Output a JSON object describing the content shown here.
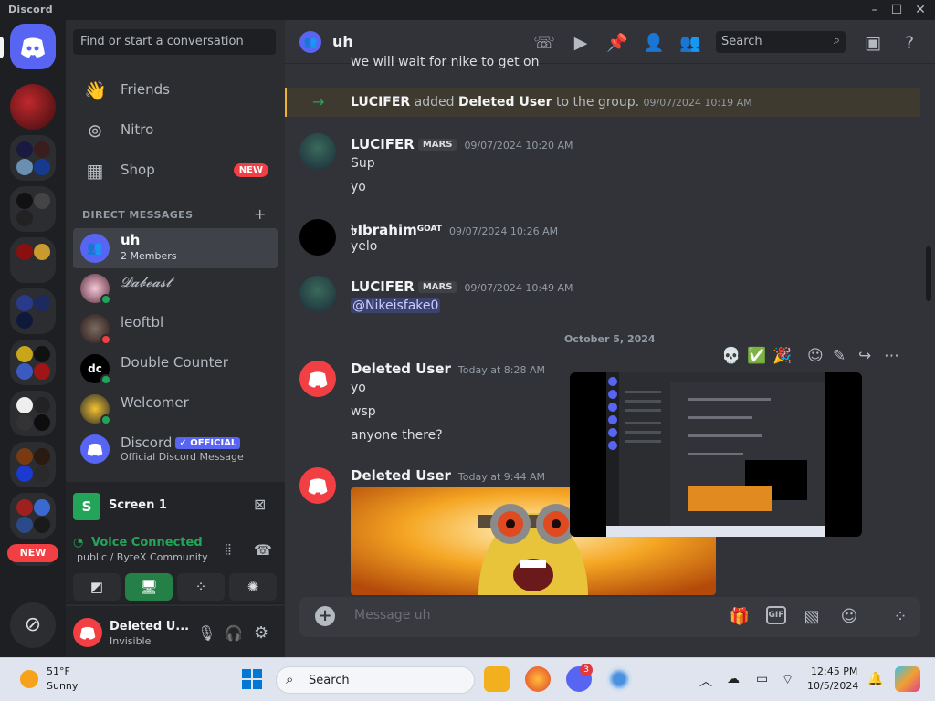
{
  "window": {
    "title": "Discord"
  },
  "rail": {
    "new_badge": "NEW"
  },
  "sidebar": {
    "search_placeholder": "Find or start a conversation",
    "nav": [
      {
        "label": "Friends",
        "icon": "friends-icon"
      },
      {
        "label": "Nitro",
        "icon": "nitro-icon"
      },
      {
        "label": "Shop",
        "icon": "shop-icon",
        "badge": "NEW"
      }
    ],
    "dm_header": "DIRECT MESSAGES",
    "dms": [
      {
        "name": "uh",
        "sub": "2 Members",
        "active": true
      },
      {
        "name": "𝓓𝓪𝓫𝓮𝓪𝓼𝓽"
      },
      {
        "name": "leoftbl"
      },
      {
        "name": "Double Counter"
      },
      {
        "name": "Welcomer"
      },
      {
        "name": "Discord",
        "badge": "✓ OFFICIAL",
        "sub": "Official Discord Message"
      }
    ]
  },
  "voice": {
    "screen_label": "Screen 1",
    "screen_letter": "S",
    "status": "Voice Connected",
    "channel": "public / ByteX Community"
  },
  "user": {
    "name": "Deleted U...",
    "status": "Invisible"
  },
  "chat": {
    "title": "uh",
    "search_placeholder": "Search",
    "clipped_line": "we will wait for nike to get on",
    "system": {
      "actor": "LUCIFER",
      "verb": "added",
      "target": "Deleted User",
      "rest": "to the group.",
      "time": "09/07/2024 10:19 AM"
    },
    "messages": [
      {
        "author": "LUCIFER",
        "tag": "MARS",
        "time": "09/07/2024 10:20 AM",
        "lines": [
          "Sup",
          "yo"
        ]
      },
      {
        "author": "৳Ibrahim",
        "suffix": "GOAT",
        "time": "09/07/2024 10:26 AM",
        "lines": [
          "yelo"
        ]
      },
      {
        "author": "LUCIFER",
        "tag": "MARS",
        "time": "09/07/2024 10:49 AM",
        "mention": "@Nikeisfake0"
      },
      {
        "author": "Deleted User",
        "time": "Today at 8:28 AM",
        "lines": [
          "yo",
          "wsp",
          "anyone there?"
        ]
      },
      {
        "author": "Deleted User",
        "time": "Today at 9:44 AM"
      }
    ],
    "date_divider": "October 5, 2024",
    "composer_placeholder": "Message uh",
    "gif_label": "GIF"
  },
  "taskbar": {
    "temp": "51°F",
    "weather": "Sunny",
    "search": "Search",
    "time": "12:45 PM",
    "date": "10/5/2024",
    "discord_badge": "3"
  },
  "colors": {
    "blurple": "#5865f2",
    "green": "#23a559",
    "red": "#f23f43",
    "bg": "#313338",
    "sidebar": "#2b2d31"
  }
}
